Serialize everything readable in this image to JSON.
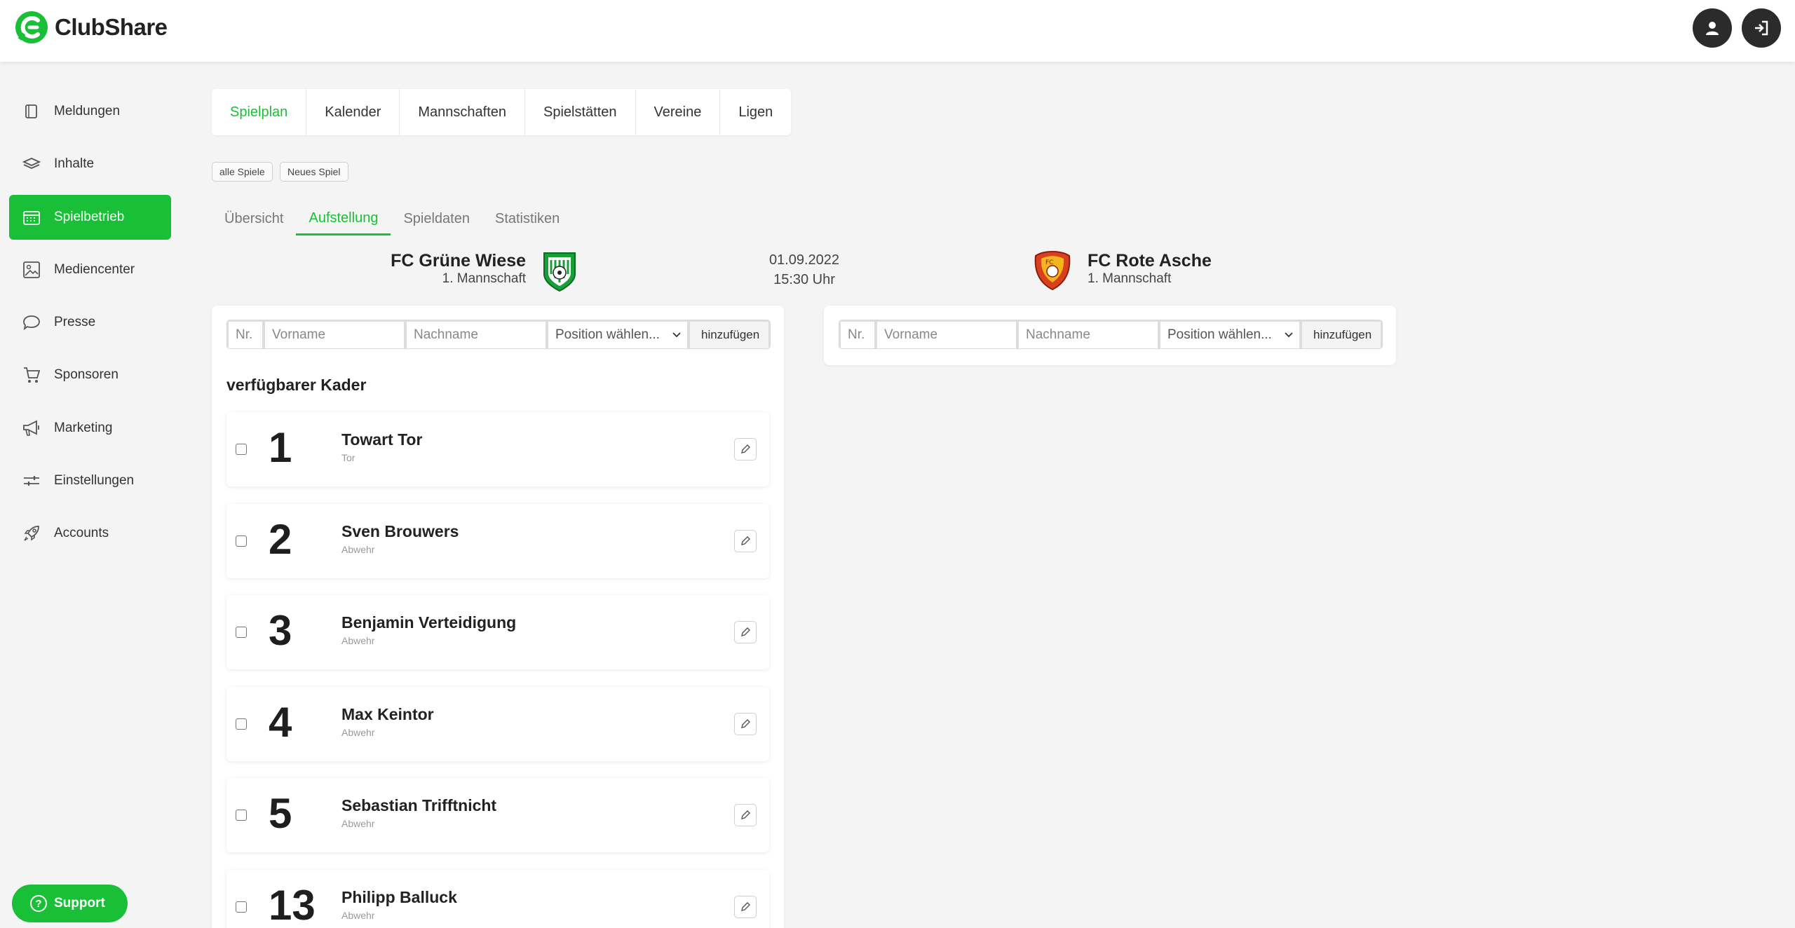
{
  "app": {
    "name": "ClubShare"
  },
  "colors": {
    "accent": "#19c037",
    "dark": "#2b2b2b"
  },
  "header": {
    "profile_icon": "user-icon",
    "logout_icon": "logout-icon"
  },
  "sidebar": {
    "items": [
      {
        "label": "Meldungen",
        "icon": "book-icon"
      },
      {
        "label": "Inhalte",
        "icon": "layers-icon"
      },
      {
        "label": "Spielbetrieb",
        "icon": "calendar-icon",
        "active": true
      },
      {
        "label": "Mediencenter",
        "icon": "image-icon"
      },
      {
        "label": "Presse",
        "icon": "chat-icon"
      },
      {
        "label": "Sponsoren",
        "icon": "cart-icon"
      },
      {
        "label": "Marketing",
        "icon": "megaphone-icon"
      },
      {
        "label": "Einstellungen",
        "icon": "sliders-icon"
      },
      {
        "label": "Accounts",
        "icon": "rocket-icon"
      }
    ],
    "support_label": "Support"
  },
  "main": {
    "tabs": [
      "Spielplan",
      "Kalender",
      "Mannschaften",
      "Spielstätten",
      "Vereine",
      "Ligen"
    ],
    "active_tab": "Spielplan",
    "chips": [
      "alle Spiele",
      "Neues Spiel"
    ],
    "subtabs": [
      "Übersicht",
      "Aufstellung",
      "Spieldaten",
      "Statistiken"
    ],
    "active_subtab": "Aufstellung"
  },
  "match": {
    "home": {
      "name": "FC Grüne Wiese",
      "team": "1. Mannschaft"
    },
    "away": {
      "name": "FC Rote Asche",
      "team": "1. Mannschaft"
    },
    "date": "01.09.2022",
    "time": "15:30 Uhr"
  },
  "form": {
    "nr_placeholder": "Nr.",
    "vorname_placeholder": "Vorname",
    "nachname_placeholder": "Nachname",
    "position_placeholder": "Position wählen...",
    "add_label": "hinzufügen"
  },
  "kader": {
    "title": "verfügbarer Kader",
    "players": [
      {
        "number": "1",
        "name": "Towart Tor",
        "position": "Tor"
      },
      {
        "number": "2",
        "name": "Sven Brouwers",
        "position": "Abwehr"
      },
      {
        "number": "3",
        "name": "Benjamin Verteidigung",
        "position": "Abwehr"
      },
      {
        "number": "4",
        "name": "Max Keintor",
        "position": "Abwehr"
      },
      {
        "number": "5",
        "name": "Sebastian Trifftnicht",
        "position": "Abwehr"
      },
      {
        "number": "13",
        "name": "Philipp Balluck",
        "position": "Abwehr"
      }
    ]
  }
}
